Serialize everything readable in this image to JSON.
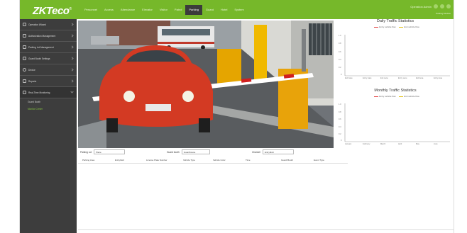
{
  "app": {
    "logo": "ZKTeco",
    "logo_tm": "®"
  },
  "nav": [
    "Personnel",
    "Access",
    "Attendance",
    "Elevator",
    "Visitor",
    "Patrol",
    "Parking",
    "Guard",
    "Hotel",
    "System"
  ],
  "nav_active_index": 6,
  "topbar": {
    "user": "Operation Admin",
    "sub": "Parking Module"
  },
  "sidebar": {
    "items": [
      "Operation Wizard",
      "Authorization Management",
      "Parking Lot Management",
      "Guard Booth Settings",
      "Device",
      "Reports",
      "Real-Time Monitoring"
    ],
    "subitems": [
      "Guard Booth",
      "Monitor Center"
    ]
  },
  "charts": {
    "daily": {
      "title": "Daily Traffic Statistics",
      "legend": [
        "Entry vehicle flow",
        "Exit vehicle flow"
      ],
      "xticks": [
        "Exit Gate",
        "Entry Gate",
        "Exit Lane",
        "Entry Lane",
        "Exit Area",
        "Entry Area"
      ],
      "yticks": [
        "1.0",
        "0.8",
        "0.6",
        "0.4",
        "0.2",
        "0"
      ]
    },
    "monthly": {
      "title": "Monthly Traffic Statistics",
      "legend": [
        "Entry vehicle flow",
        "Exit vehicle flow"
      ],
      "xticks": [
        "January",
        "February",
        "March",
        "April",
        "May",
        "June"
      ],
      "yticks": [
        "1.0",
        "0.8",
        "0.6",
        "0.4",
        "0.2",
        "0"
      ]
    }
  },
  "form": {
    "parking_lot_label": "Parking Lot",
    "parking_lot_value": "Place",
    "guard_label": "Guard booth",
    "guard_value": "Guardhouse",
    "channel_label": "Channel",
    "channel_value": "Entry/Exit"
  },
  "table": {
    "headers": [
      "Parking Area",
      "Entry/Exit",
      "License Plate Number",
      "Vehicle Type",
      "Vehicle Color",
      "Time",
      "Guard Booth",
      "Event Type"
    ]
  }
}
